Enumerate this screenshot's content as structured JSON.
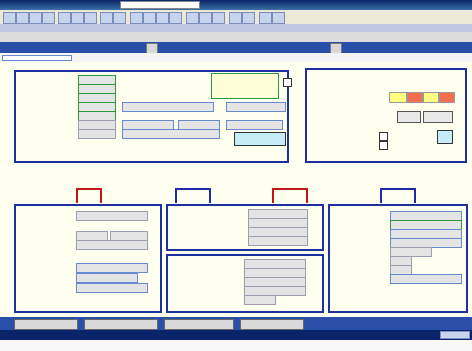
{
  "window": {
    "title": "",
    "search_value": ""
  },
  "toolbar": {
    "right_link": ""
  },
  "tabs": {
    "left": "",
    "center": "",
    "right_a": "",
    "right_b": ""
  },
  "subheader": {
    "caption": "",
    "right_caption": ""
  },
  "form": {
    "labels": [
      "",
      "",
      "",
      "",
      "",
      "",
      ""
    ],
    "fields": [
      "",
      "",
      "",
      "",
      "",
      "",
      ""
    ]
  },
  "center_block": {
    "labels": [
      "",
      "",
      ""
    ],
    "note": "",
    "options": [
      "",
      ""
    ],
    "footer_label": ""
  },
  "top_right": {
    "labels": [
      "",
      "",
      "",
      "",
      ""
    ],
    "values": [
      "",
      "",
      "",
      "",
      "",
      ""
    ]
  },
  "mid_row": {
    "labels": [
      "",
      "",
      ""
    ],
    "values": [
      "",
      "",
      ""
    ]
  },
  "panels": {
    "left": {
      "labels": [
        "",
        "",
        "",
        "",
        "",
        ""
      ]
    },
    "center_top": {
      "labels": [
        "",
        "",
        "",
        ""
      ]
    },
    "center_bottom": {
      "labels": [
        "",
        "",
        "",
        "",
        ""
      ]
    },
    "right": {
      "labels": [
        "",
        "",
        "",
        "",
        "",
        "",
        "",
        ""
      ]
    }
  },
  "bottom_tabs": [
    "",
    "",
    "",
    ""
  ],
  "status": {
    "text": ""
  },
  "colors": {
    "accent_blue": "#2a4fa8",
    "panel_border": "#1e2fa0",
    "label_text": "#10106a",
    "form_background": "#fffff0",
    "highlight_yellow": "#ffff80",
    "highlight_red": "#f07050",
    "highlight_cyan": "#c6ecf8",
    "title_bar": "#0a246a"
  }
}
